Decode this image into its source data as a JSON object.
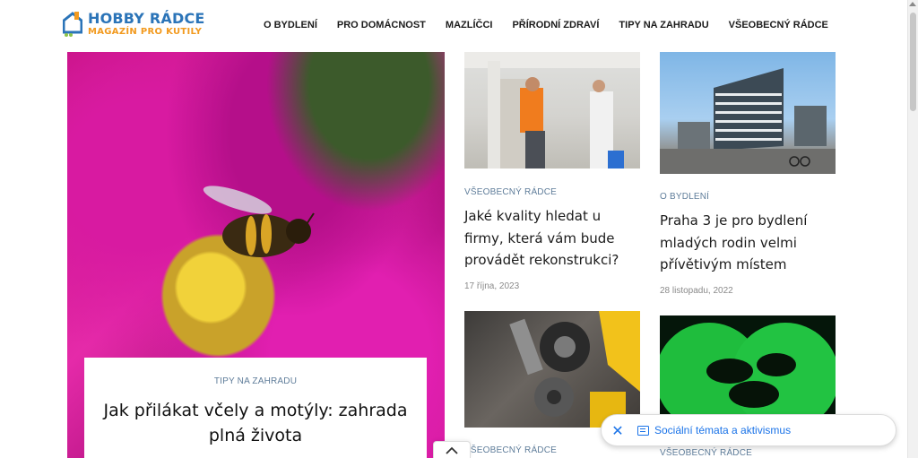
{
  "logo": {
    "title": "HOBBY RÁDCE",
    "subtitle": "MAGAZÍN PRO KUTILY"
  },
  "nav": [
    {
      "label": "O BYDLENÍ"
    },
    {
      "label": "PRO DOMÁCNOST"
    },
    {
      "label": "MAZLÍČCI"
    },
    {
      "label": "PŘÍRODNÍ ZDRAVÍ"
    },
    {
      "label": "TIPY NA ZAHRADU"
    },
    {
      "label": "VŠEOBECNÝ RÁDCE"
    }
  ],
  "hero": {
    "category": "TIPY NA ZAHRADU",
    "title": "Jak přilákat včely a motýly: zahrada plná života"
  },
  "posts": [
    {
      "category": "VŠEOBECNÝ RÁDCE",
      "title": "Jaké kvality hledat u firmy, která vám bude provádět rekonstrukci?",
      "date": "17 října, 2023"
    },
    {
      "category": "O BYDLENÍ",
      "title": "Praha 3 je pro bydlení mladých rodin velmi přívětivým místem",
      "date": "28 listopadu, 2022"
    },
    {
      "category": "VŠEOBECNÝ RÁDCE"
    },
    {
      "category": "VŠEOBECNÝ RÁDCE"
    }
  ],
  "chip": {
    "label": "Sociální témata a aktivismus"
  },
  "colors": {
    "brand_blue": "#2b74b8",
    "brand_orange": "#f29a1f",
    "category": "#5f7d9a",
    "link_blue": "#1a73e8"
  }
}
